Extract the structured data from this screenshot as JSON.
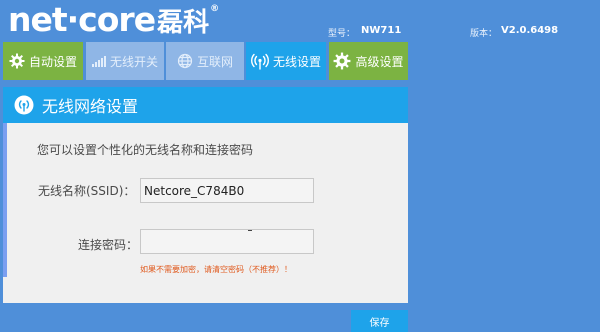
{
  "brand": {
    "logo_text": "net·core",
    "logo_cn": "磊科",
    "logo_mark": "®"
  },
  "device": {
    "model_label": "型号：",
    "model_value": "NW711",
    "version_label": "版本：",
    "version_value": "V2.0.6498"
  },
  "nav": {
    "auto_setup": "自动设置",
    "wireless_switch": "无线开关",
    "internet": "互联网",
    "wireless_settings": "无线设置",
    "advanced_settings": "高级设置"
  },
  "panel": {
    "title": "无线网络设置",
    "intro": "您可以设置个性化的无线名称和连接密码",
    "ssid_label": "无线名称(SSID)：",
    "ssid_value": "Netcore_C784B0",
    "password_label": "连接密码：",
    "password_value": "",
    "hint": "如果不需要加密，请清空密码（不推荐）！"
  },
  "actions": {
    "save_label": "保存"
  },
  "colors": {
    "background": "#4f8fd9",
    "green": "#7cb342",
    "active_blue": "#1ea3ea",
    "hint_orange": "#e05a1e"
  },
  "icons": {
    "auto_setup": "gear-icon",
    "wireless_switch": "signal-bars-icon",
    "internet": "globe-icon",
    "wireless_settings": "wifi-antenna-icon",
    "advanced_settings": "gear-icon",
    "panel": "wifi-antenna-icon"
  }
}
